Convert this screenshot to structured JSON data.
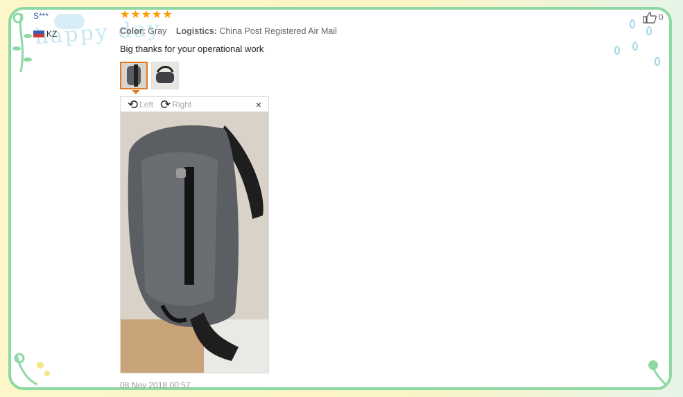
{
  "reviewer": {
    "name": "S***",
    "country": "KZ"
  },
  "rating": {
    "stars": 5,
    "max": 5
  },
  "order": {
    "color_label": "Color:",
    "color_value": "Gray",
    "logistics_label": "Logistics:",
    "logistics_value": "China Post Registered Air Mail"
  },
  "feedback": {
    "text": "Big thanks for your operational work"
  },
  "photos": {
    "count": 2,
    "selected_index": 0
  },
  "viewer": {
    "rotate_left_label": "Left",
    "rotate_right_label": "Right",
    "close_glyph": "×"
  },
  "date": "08 Nov 2018 00:57",
  "helpful": {
    "count": "0"
  },
  "colors": {
    "accent": "#e07b23",
    "star": "#ff9a00",
    "frame": "#8ed8a4"
  },
  "icons": [
    "rotate-left-icon",
    "rotate-right-icon",
    "close-icon",
    "thumbs-up-icon",
    "star-icon",
    "flag-icon"
  ]
}
